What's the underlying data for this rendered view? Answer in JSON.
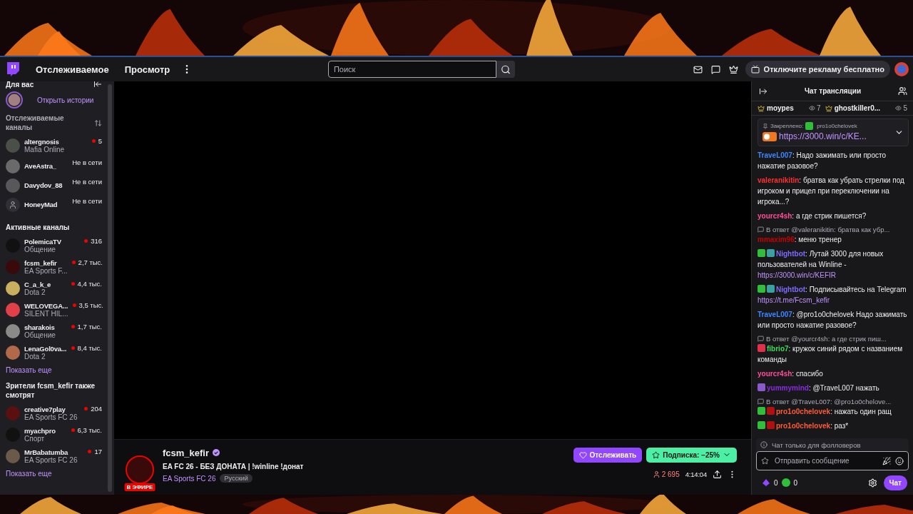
{
  "topbar": {
    "nav": [
      "Отслеживаемое",
      "Просмотр"
    ],
    "search": {
      "placeholder": "Поиск"
    },
    "ad_button": "Отключите рекламу бесплатно"
  },
  "sidebar": {
    "section_title": "Для вас",
    "stories_link": "Открыть истории",
    "followed": {
      "title": "Отслеживаемые каналы",
      "channels": [
        {
          "name": "altergnosis",
          "game": "Mafia Online",
          "live": true,
          "viewers": "5",
          "kind": "picture"
        },
        {
          "name": "AveAstra_",
          "live": false,
          "status": "Не в сети",
          "kind": "picture"
        },
        {
          "name": "Davydov_88",
          "live": false,
          "status": "Не в сети",
          "kind": "picture"
        },
        {
          "name": "HoneyMad",
          "live": false,
          "status": "Не в сети",
          "kind": "default"
        }
      ]
    },
    "active": {
      "title": "Активные каналы",
      "show_more": "Показать еще",
      "channels": [
        {
          "name": "PolemicaTV",
          "game": "Общение",
          "live": true,
          "viewers": "316",
          "kind": "picture"
        },
        {
          "name": "fcsm_kefir",
          "game": "EA Sports F...",
          "live": true,
          "viewers": "2,7 тыс.",
          "kind": "picture"
        },
        {
          "name": "C_a_k_e",
          "game": "Dota 2",
          "live": true,
          "viewers": "4,4 тыс.",
          "kind": "picture"
        },
        {
          "name": "WELOVEGA...",
          "game": "SILENT HIL...",
          "live": true,
          "viewers": "3,5 тыс.",
          "kind": "picture"
        },
        {
          "name": "sharakois",
          "game": "Общение",
          "live": true,
          "viewers": "1,7 тыс.",
          "kind": "picture"
        },
        {
          "name": "LenaGol0va...",
          "game": "Dota 2",
          "live": true,
          "viewers": "8,4 тыс.",
          "kind": "picture"
        }
      ]
    },
    "also_watch": {
      "title": "Зрители fcsm_kefir также смотрят",
      "show_more": "Показать еще",
      "channels": [
        {
          "name": "creative7play",
          "game": "EA Sports FC 26",
          "live": true,
          "viewers": "204",
          "kind": "picture"
        },
        {
          "name": "myachpro",
          "game": "Спорт",
          "live": true,
          "viewers": "6,3 тыс.",
          "kind": "picture"
        },
        {
          "name": "MrBabatumba",
          "game": "EA Sports FC 26",
          "live": true,
          "viewers": "17",
          "kind": "picture"
        }
      ]
    }
  },
  "stream": {
    "channel": "fcsm_kefir",
    "verified": true,
    "live_badge": "В ЭФИРЕ",
    "title": "EA FC 26 - БЕЗ ДОНАТА | !winline !донат",
    "game": "EA Sports FC 26",
    "tag": "Русский",
    "follow_button": "Отслеживать",
    "subscribe_button": "Подписка: −25%",
    "viewers": "2 695",
    "uptime": "4:14:04"
  },
  "chat": {
    "title": "Чат трансляции",
    "top_chatters": [
      {
        "name": "moypes",
        "count": "7"
      },
      {
        "name": "ghostkiller0...",
        "count": "5"
      }
    ],
    "pinned": {
      "label": "Закреплено:",
      "user": "pro1o0chelovek",
      "link": "https://3000.win/c/KE..."
    },
    "messages": [
      {
        "user": "TraveL007",
        "color": "#3d86ff",
        "text": ": Надо зажимать или просто нажатие разовое?"
      },
      {
        "user": "valeranikitin",
        "color": "#ff3030",
        "text": ": братва как убрать стрелки под игроком и прицел при переключении на игрока...?"
      },
      {
        "user": "yourcr4sh",
        "color": "#ff4f9a",
        "text": ": а где стрик пишется?"
      },
      {
        "user": "mmaxim96",
        "color": "#c80000",
        "reply": "В ответ @valeranikitin: братва как убр...",
        "text": ": меню тренер"
      },
      {
        "user": "Nightbot",
        "color": "#7d6bff",
        "badges": [
          {
            "kind": "sword"
          },
          {
            "kind": "bot"
          }
        ],
        "text": ": Лутай 3000 для новых пользователей на Winline -",
        "link": "https://3000.win/c/KEFIR"
      },
      {
        "user": "Nightbot",
        "color": "#7d6bff",
        "badges": [
          {
            "kind": "sword"
          },
          {
            "kind": "bot"
          }
        ],
        "text": ": Подписывайтесь на Telegram",
        "link": "https://t.me/Fcsm_kefir"
      },
      {
        "user": "TraveL007",
        "color": "#3d86ff",
        "text": ": @pro1o0chelovek Надо зажимать или просто нажатие разовое?"
      },
      {
        "user": "fibrio7",
        "color": "#3ddc5a",
        "badges": [
          {
            "kind": "heart"
          }
        ],
        "reply": "В ответ @yourcr4sh: а где стрик пиш...",
        "text": ": кружок синий рядом с названием команды"
      },
      {
        "user": "yourcr4sh",
        "color": "#ff4f9a",
        "text": ": спасибо"
      },
      {
        "user": "yummymind",
        "color": "#8a2be2",
        "badges": [
          {
            "kind": "pixel"
          }
        ],
        "text": ": @TraveL007 нажать"
      },
      {
        "user": "pro1o0chelovek",
        "color": "#ff5a36",
        "badges": [
          {
            "kind": "sword"
          },
          {
            "kind": "target"
          }
        ],
        "reply": "В ответ @TraveL007: @pro1o0chelove...",
        "text": ": нажать один ращ"
      },
      {
        "user": "pro1o0chelovek",
        "color": "#ff5a36",
        "badges": [
          {
            "kind": "sword"
          },
          {
            "kind": "target"
          }
        ],
        "text": ": раз*"
      }
    ],
    "notice": "Чат только для фолловеров",
    "input": {
      "placeholder": "Отправить сообщение"
    },
    "points": "0",
    "bits": "0",
    "chat_button": "Чат"
  }
}
